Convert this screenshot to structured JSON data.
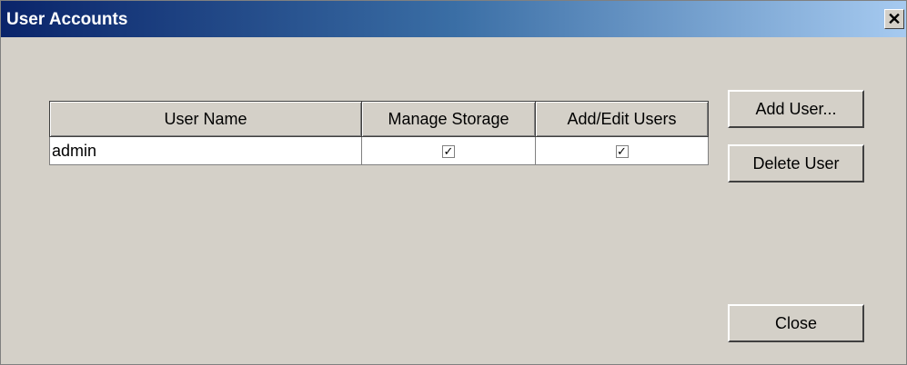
{
  "window": {
    "title": "User Accounts",
    "close_glyph": "✕"
  },
  "table": {
    "headers": [
      "User Name",
      "Manage Storage",
      "Add/Edit Users"
    ],
    "rows": [
      {
        "user_name": "admin",
        "manage_storage": true,
        "add_edit_users": true
      }
    ]
  },
  "buttons": {
    "add_user": "Add User...",
    "delete_user": "Delete User",
    "close": "Close"
  },
  "checkmark_glyph": "✓",
  "colors": {
    "title_start": "#0a246a",
    "title_end": "#a6caf0",
    "face": "#d4d0c8"
  }
}
